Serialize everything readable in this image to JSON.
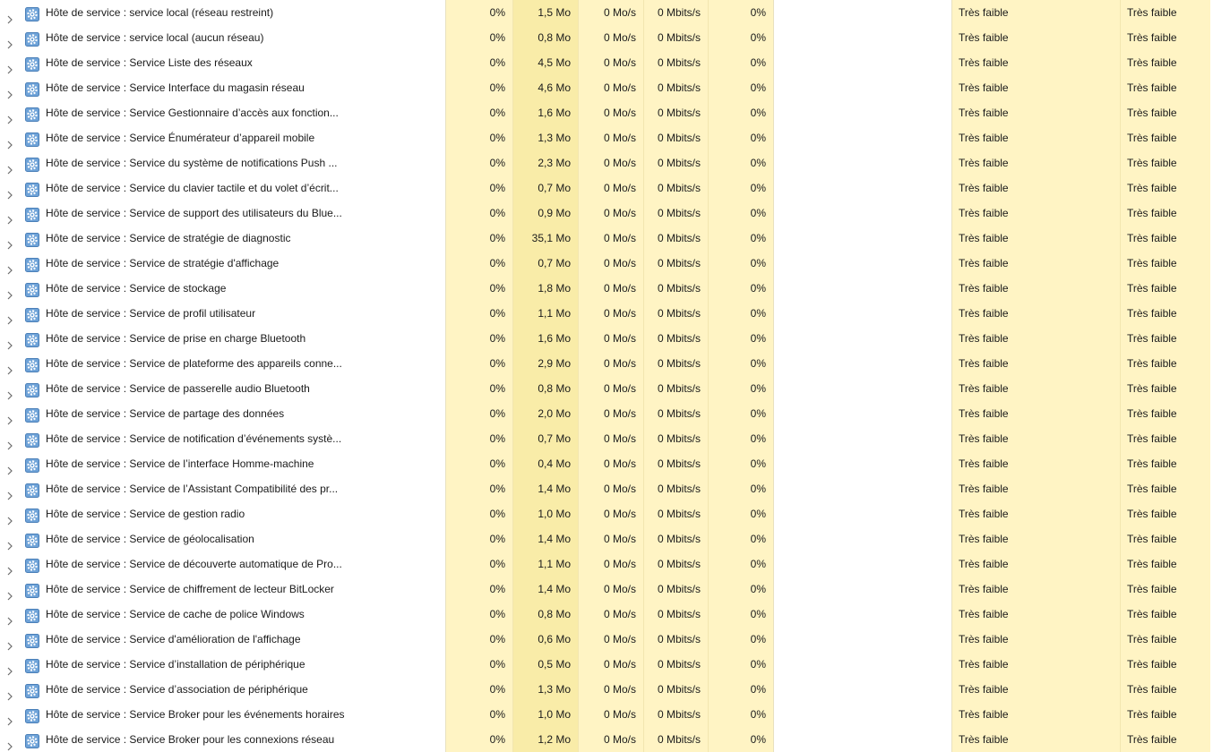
{
  "expand_icon": "chevron-right-icon",
  "process_icon": "gear-icon",
  "accent_colors": {
    "cell_bg": "#fff4c4",
    "memory_bg": "#f9eca8"
  },
  "rows": [
    {
      "name": "Hôte de service : service local (réseau restreint)",
      "cpu": "0%",
      "memory": "1,5 Mo",
      "disk": "0 Mo/s",
      "network": "0 Mbits/s",
      "gpu": "0%",
      "gpu_engine": "",
      "power": "Très faible",
      "power_trend": "Très faible"
    },
    {
      "name": "Hôte de service : service local (aucun réseau)",
      "cpu": "0%",
      "memory": "0,8 Mo",
      "disk": "0 Mo/s",
      "network": "0 Mbits/s",
      "gpu": "0%",
      "gpu_engine": "",
      "power": "Très faible",
      "power_trend": "Très faible"
    },
    {
      "name": "Hôte de service : Service Liste des réseaux",
      "cpu": "0%",
      "memory": "4,5 Mo",
      "disk": "0 Mo/s",
      "network": "0 Mbits/s",
      "gpu": "0%",
      "gpu_engine": "",
      "power": "Très faible",
      "power_trend": "Très faible"
    },
    {
      "name": "Hôte de service : Service Interface du magasin réseau",
      "cpu": "0%",
      "memory": "4,6 Mo",
      "disk": "0 Mo/s",
      "network": "0 Mbits/s",
      "gpu": "0%",
      "gpu_engine": "",
      "power": "Très faible",
      "power_trend": "Très faible"
    },
    {
      "name": "Hôte de service : Service Gestionnaire d’accès aux fonction...",
      "cpu": "0%",
      "memory": "1,6 Mo",
      "disk": "0 Mo/s",
      "network": "0 Mbits/s",
      "gpu": "0%",
      "gpu_engine": "",
      "power": "Très faible",
      "power_trend": "Très faible"
    },
    {
      "name": "Hôte de service : Service Énumérateur d’appareil mobile",
      "cpu": "0%",
      "memory": "1,3 Mo",
      "disk": "0 Mo/s",
      "network": "0 Mbits/s",
      "gpu": "0%",
      "gpu_engine": "",
      "power": "Très faible",
      "power_trend": "Très faible"
    },
    {
      "name": "Hôte de service : Service du système de notifications Push ...",
      "cpu": "0%",
      "memory": "2,3 Mo",
      "disk": "0 Mo/s",
      "network": "0 Mbits/s",
      "gpu": "0%",
      "gpu_engine": "",
      "power": "Très faible",
      "power_trend": "Très faible"
    },
    {
      "name": "Hôte de service : Service du clavier tactile et du volet d’écrit...",
      "cpu": "0%",
      "memory": "0,7 Mo",
      "disk": "0 Mo/s",
      "network": "0 Mbits/s",
      "gpu": "0%",
      "gpu_engine": "",
      "power": "Très faible",
      "power_trend": "Très faible"
    },
    {
      "name": "Hôte de service : Service de support des utilisateurs du Blue...",
      "cpu": "0%",
      "memory": "0,9 Mo",
      "disk": "0 Mo/s",
      "network": "0 Mbits/s",
      "gpu": "0%",
      "gpu_engine": "",
      "power": "Très faible",
      "power_trend": "Très faible"
    },
    {
      "name": "Hôte de service : Service de stratégie de diagnostic",
      "cpu": "0%",
      "memory": "35,1 Mo",
      "disk": "0 Mo/s",
      "network": "0 Mbits/s",
      "gpu": "0%",
      "gpu_engine": "",
      "power": "Très faible",
      "power_trend": "Très faible"
    },
    {
      "name": "Hôte de service : Service de stratégie d'affichage",
      "cpu": "0%",
      "memory": "0,7 Mo",
      "disk": "0 Mo/s",
      "network": "0 Mbits/s",
      "gpu": "0%",
      "gpu_engine": "",
      "power": "Très faible",
      "power_trend": "Très faible"
    },
    {
      "name": "Hôte de service : Service de stockage",
      "cpu": "0%",
      "memory": "1,8 Mo",
      "disk": "0 Mo/s",
      "network": "0 Mbits/s",
      "gpu": "0%",
      "gpu_engine": "",
      "power": "Très faible",
      "power_trend": "Très faible"
    },
    {
      "name": "Hôte de service : Service de profil utilisateur",
      "cpu": "0%",
      "memory": "1,1 Mo",
      "disk": "0 Mo/s",
      "network": "0 Mbits/s",
      "gpu": "0%",
      "gpu_engine": "",
      "power": "Très faible",
      "power_trend": "Très faible"
    },
    {
      "name": "Hôte de service : Service de prise en charge Bluetooth",
      "cpu": "0%",
      "memory": "1,6 Mo",
      "disk": "0 Mo/s",
      "network": "0 Mbits/s",
      "gpu": "0%",
      "gpu_engine": "",
      "power": "Très faible",
      "power_trend": "Très faible"
    },
    {
      "name": "Hôte de service : Service de plateforme des appareils conne...",
      "cpu": "0%",
      "memory": "2,9 Mo",
      "disk": "0 Mo/s",
      "network": "0 Mbits/s",
      "gpu": "0%",
      "gpu_engine": "",
      "power": "Très faible",
      "power_trend": "Très faible"
    },
    {
      "name": "Hôte de service : Service de passerelle audio Bluetooth",
      "cpu": "0%",
      "memory": "0,8 Mo",
      "disk": "0 Mo/s",
      "network": "0 Mbits/s",
      "gpu": "0%",
      "gpu_engine": "",
      "power": "Très faible",
      "power_trend": "Très faible"
    },
    {
      "name": "Hôte de service : Service de partage des données",
      "cpu": "0%",
      "memory": "2,0 Mo",
      "disk": "0 Mo/s",
      "network": "0 Mbits/s",
      "gpu": "0%",
      "gpu_engine": "",
      "power": "Très faible",
      "power_trend": "Très faible"
    },
    {
      "name": "Hôte de service : Service de notification d’événements systè...",
      "cpu": "0%",
      "memory": "0,7 Mo",
      "disk": "0 Mo/s",
      "network": "0 Mbits/s",
      "gpu": "0%",
      "gpu_engine": "",
      "power": "Très faible",
      "power_trend": "Très faible"
    },
    {
      "name": "Hôte de service : Service de l’interface Homme-machine",
      "cpu": "0%",
      "memory": "0,4 Mo",
      "disk": "0 Mo/s",
      "network": "0 Mbits/s",
      "gpu": "0%",
      "gpu_engine": "",
      "power": "Très faible",
      "power_trend": "Très faible"
    },
    {
      "name": "Hôte de service : Service de l’Assistant Compatibilité des pr...",
      "cpu": "0%",
      "memory": "1,4 Mo",
      "disk": "0 Mo/s",
      "network": "0 Mbits/s",
      "gpu": "0%",
      "gpu_engine": "",
      "power": "Très faible",
      "power_trend": "Très faible"
    },
    {
      "name": "Hôte de service : Service de gestion radio",
      "cpu": "0%",
      "memory": "1,0 Mo",
      "disk": "0 Mo/s",
      "network": "0 Mbits/s",
      "gpu": "0%",
      "gpu_engine": "",
      "power": "Très faible",
      "power_trend": "Très faible"
    },
    {
      "name": "Hôte de service : Service de géolocalisation",
      "cpu": "0%",
      "memory": "1,4 Mo",
      "disk": "0 Mo/s",
      "network": "0 Mbits/s",
      "gpu": "0%",
      "gpu_engine": "",
      "power": "Très faible",
      "power_trend": "Très faible"
    },
    {
      "name": "Hôte de service : Service de découverte automatique de Pro...",
      "cpu": "0%",
      "memory": "1,1 Mo",
      "disk": "0 Mo/s",
      "network": "0 Mbits/s",
      "gpu": "0%",
      "gpu_engine": "",
      "power": "Très faible",
      "power_trend": "Très faible"
    },
    {
      "name": "Hôte de service : Service de chiffrement de lecteur BitLocker",
      "cpu": "0%",
      "memory": "1,4 Mo",
      "disk": "0 Mo/s",
      "network": "0 Mbits/s",
      "gpu": "0%",
      "gpu_engine": "",
      "power": "Très faible",
      "power_trend": "Très faible"
    },
    {
      "name": "Hôte de service : Service de cache de police Windows",
      "cpu": "0%",
      "memory": "0,8 Mo",
      "disk": "0 Mo/s",
      "network": "0 Mbits/s",
      "gpu": "0%",
      "gpu_engine": "",
      "power": "Très faible",
      "power_trend": "Très faible"
    },
    {
      "name": "Hôte de service : Service d'amélioration de l'affichage",
      "cpu": "0%",
      "memory": "0,6 Mo",
      "disk": "0 Mo/s",
      "network": "0 Mbits/s",
      "gpu": "0%",
      "gpu_engine": "",
      "power": "Très faible",
      "power_trend": "Très faible"
    },
    {
      "name": "Hôte de service : Service d’installation de périphérique",
      "cpu": "0%",
      "memory": "0,5 Mo",
      "disk": "0 Mo/s",
      "network": "0 Mbits/s",
      "gpu": "0%",
      "gpu_engine": "",
      "power": "Très faible",
      "power_trend": "Très faible"
    },
    {
      "name": "Hôte de service : Service d’association de périphérique",
      "cpu": "0%",
      "memory": "1,3 Mo",
      "disk": "0 Mo/s",
      "network": "0 Mbits/s",
      "gpu": "0%",
      "gpu_engine": "",
      "power": "Très faible",
      "power_trend": "Très faible"
    },
    {
      "name": "Hôte de service : Service Broker pour les événements horaires",
      "cpu": "0%",
      "memory": "1,0 Mo",
      "disk": "0 Mo/s",
      "network": "0 Mbits/s",
      "gpu": "0%",
      "gpu_engine": "",
      "power": "Très faible",
      "power_trend": "Très faible"
    },
    {
      "name": "Hôte de service : Service Broker pour les connexions réseau",
      "cpu": "0%",
      "memory": "1,2 Mo",
      "disk": "0 Mo/s",
      "network": "0 Mbits/s",
      "gpu": "0%",
      "gpu_engine": "",
      "power": "Très faible",
      "power_trend": "Très faible"
    }
  ]
}
